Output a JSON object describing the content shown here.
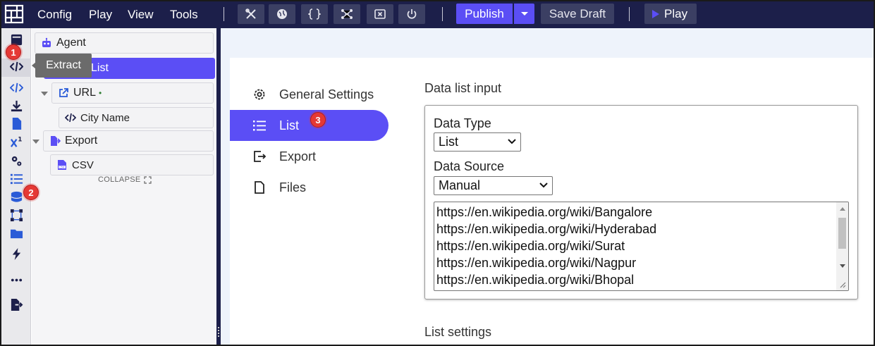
{
  "topbar": {
    "menu": [
      "Config",
      "Play",
      "View",
      "Tools"
    ],
    "toolbar_icons": [
      "tools-icon",
      "globe-icon",
      "braces-icon",
      "network-icon",
      "close-file-icon",
      "power-icon"
    ],
    "publish_label": "Publish",
    "save_draft_label": "Save Draft",
    "play_label": "Play"
  },
  "rail": {
    "icons": [
      "database-icon",
      "code-icon",
      "code-small-icon",
      "download-icon",
      "file-icon",
      "superscript-icon",
      "cogs-icon",
      "list-icon",
      "stack-icon",
      "nodes-icon",
      "folder-icon",
      "bolt-icon",
      "more-icon",
      "export-icon"
    ]
  },
  "tooltip": {
    "text": "Extract"
  },
  "badges": {
    "one": "1",
    "two": "2",
    "three": "3"
  },
  "tree": {
    "agent": "Agent",
    "list": "List",
    "url": "URL",
    "url_marker": "•",
    "city_name": "City Name",
    "export": "Export",
    "csv": "CSV",
    "collapse": "COLLAPSE"
  },
  "subnav": {
    "items": [
      {
        "label": "General Settings",
        "icon": "gear-icon"
      },
      {
        "label": "List",
        "icon": "list-icon"
      },
      {
        "label": "Export",
        "icon": "export-icon"
      },
      {
        "label": "Files",
        "icon": "file-icon"
      }
    ],
    "active_index": 1
  },
  "main": {
    "data_list_input_title": "Data list input",
    "data_type_label": "Data Type",
    "data_type_value": "List",
    "data_source_label": "Data Source",
    "data_source_value": "Manual",
    "urls": [
      "https://en.wikipedia.org/wiki/Bangalore",
      "https://en.wikipedia.org/wiki/Hyderabad",
      "https://en.wikipedia.org/wiki/Surat",
      "https://en.wikipedia.org/wiki/Nagpur",
      "https://en.wikipedia.org/wiki/Bhopal"
    ],
    "list_settings_title": "List settings"
  },
  "colors": {
    "topbar": "#1c1f4a",
    "accent": "#5b4ef5",
    "badge": "#e53935"
  }
}
